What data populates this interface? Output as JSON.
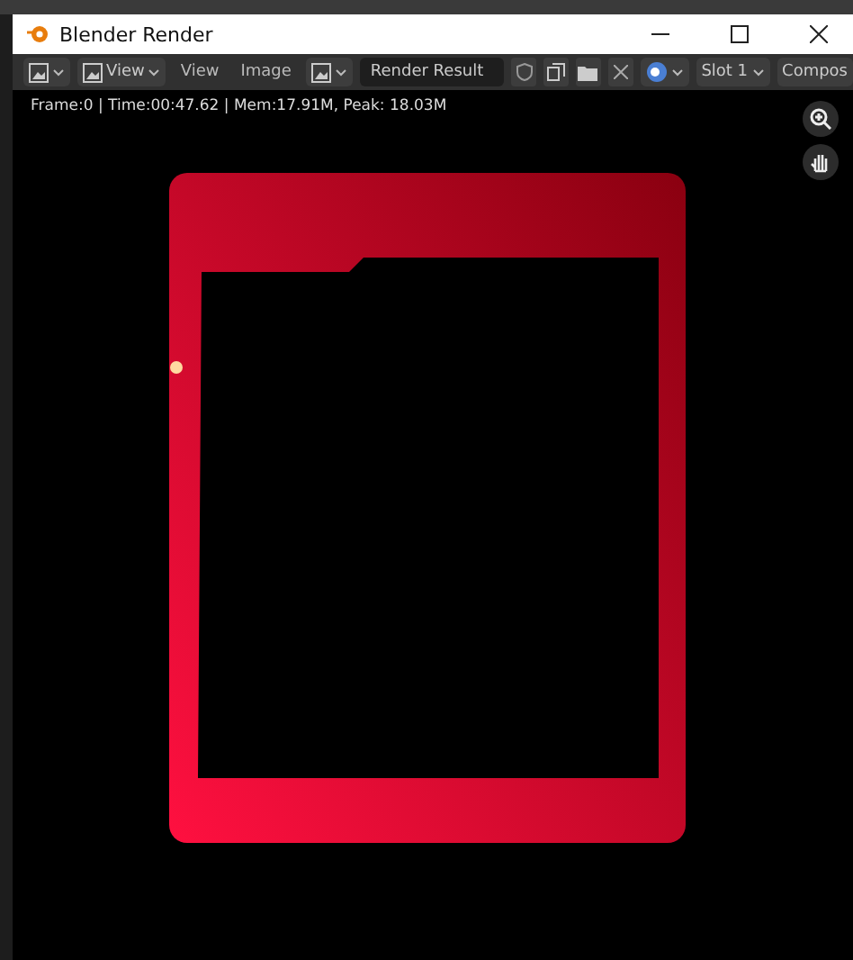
{
  "window": {
    "title": "Blender Render"
  },
  "toolbar": {
    "view_dropdown": "View",
    "menus": [
      "View",
      "Image"
    ],
    "image_name": "Render Result",
    "slot": "Slot 1",
    "layer": "Compos"
  },
  "info": "Frame:0 | Time:00:47.62 | Mem:17.91M, Peak: 18.03M"
}
